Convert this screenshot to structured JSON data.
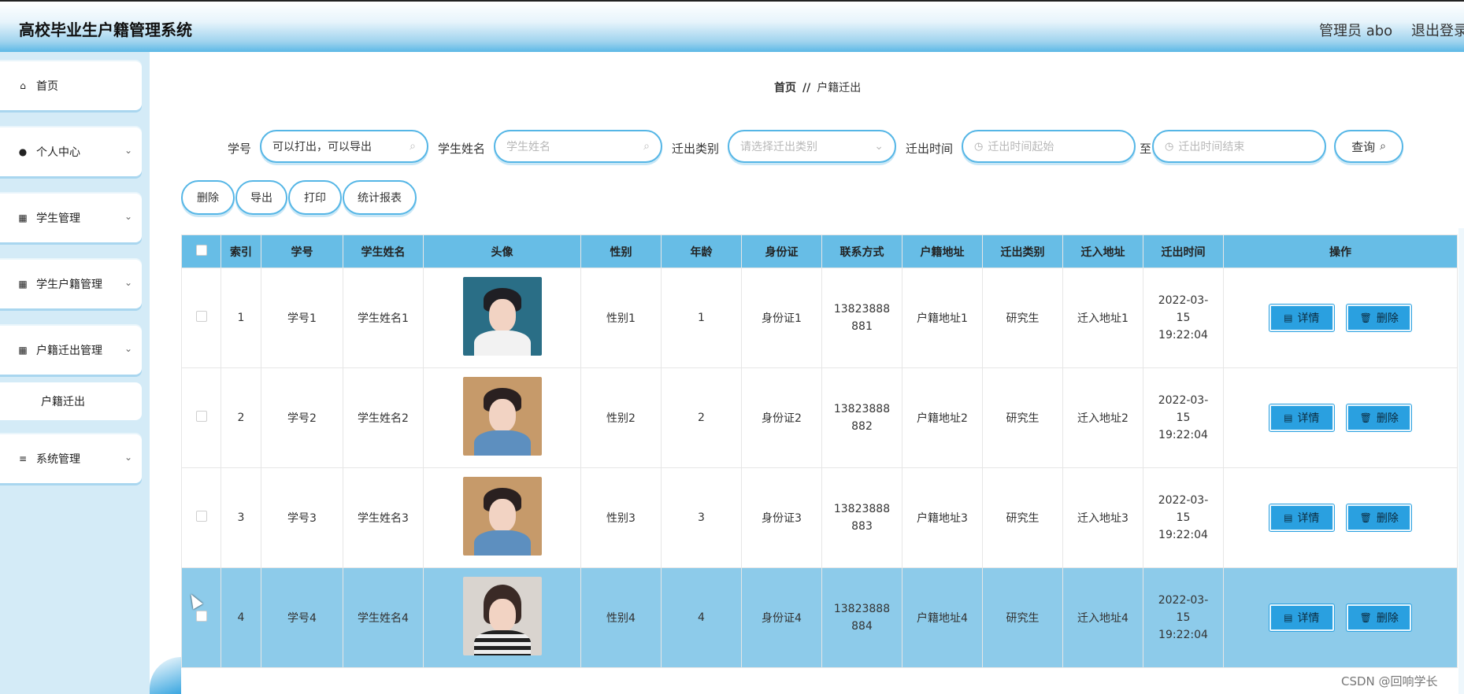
{
  "header": {
    "title": "高校毕业生户籍管理系统",
    "admin": "管理员 abo",
    "logout": "退出登录"
  },
  "sidebar": {
    "items": [
      {
        "label": "首页",
        "icon": "home-icon"
      },
      {
        "label": "个人中心",
        "icon": "user-icon"
      },
      {
        "label": "学生管理",
        "icon": "grid-icon"
      },
      {
        "label": "学生户籍管理",
        "icon": "grid-icon"
      },
      {
        "label": "户籍迁出管理",
        "icon": "grid-icon"
      },
      {
        "label": "户籍迁出",
        "icon": ""
      },
      {
        "label": "系统管理",
        "icon": "sliders-icon"
      }
    ]
  },
  "breadcrumb": {
    "home": "首页",
    "sep": "//",
    "current": "户籍迁出"
  },
  "search": {
    "xuehao_label": "学号",
    "xuehao_value": "可以打出，可以导出",
    "name_label": "学生姓名",
    "name_placeholder": "学生姓名",
    "type_label": "迁出类别",
    "type_placeholder": "请选择迁出类别",
    "time_label": "迁出时间",
    "time_start_placeholder": "迁出时间起始",
    "to_label": "至",
    "time_end_placeholder": "迁出时间结束",
    "query_label": "查询"
  },
  "actions": {
    "delete": "删除",
    "export": "导出",
    "print": "打印",
    "report": "统计报表"
  },
  "table": {
    "headers": [
      "索引",
      "学号",
      "学生姓名",
      "头像",
      "性别",
      "年龄",
      "身份证",
      "联系方式",
      "户籍地址",
      "迁出类别",
      "迁入地址",
      "迁出时间",
      "操作"
    ],
    "detail_label": "详情",
    "delete_label": "删除",
    "rows": [
      {
        "idx": "1",
        "xuehao": "学号1",
        "name": "学生姓名1",
        "gender": "性别1",
        "age": "1",
        "id": "身份证1",
        "phone": "13823888881",
        "addr": "户籍地址1",
        "type": "研究生",
        "to": "迁入地址1",
        "time": "2022-03-15 19:22:04"
      },
      {
        "idx": "2",
        "xuehao": "学号2",
        "name": "学生姓名2",
        "gender": "性别2",
        "age": "2",
        "id": "身份证2",
        "phone": "13823888882",
        "addr": "户籍地址2",
        "type": "研究生",
        "to": "迁入地址2",
        "time": "2022-03-15 19:22:04"
      },
      {
        "idx": "3",
        "xuehao": "学号3",
        "name": "学生姓名3",
        "gender": "性别3",
        "age": "3",
        "id": "身份证3",
        "phone": "13823888883",
        "addr": "户籍地址3",
        "type": "研究生",
        "to": "迁入地址3",
        "time": "2022-03-15 19:22:04"
      },
      {
        "idx": "4",
        "xuehao": "学号4",
        "name": "学生姓名4",
        "gender": "性别4",
        "age": "4",
        "id": "身份证4",
        "phone": "13823888884",
        "addr": "户籍地址4",
        "type": "研究生",
        "to": "迁入地址4",
        "time": "2022-03-15 19:22:04"
      }
    ]
  },
  "watermark": "CSDN @回响学长",
  "colors": {
    "accent": "#2aa0e0",
    "header_blue": "#67bde6",
    "highlight_row": "#8dcbea",
    "sidebar_bg": "#d4ebf7"
  }
}
